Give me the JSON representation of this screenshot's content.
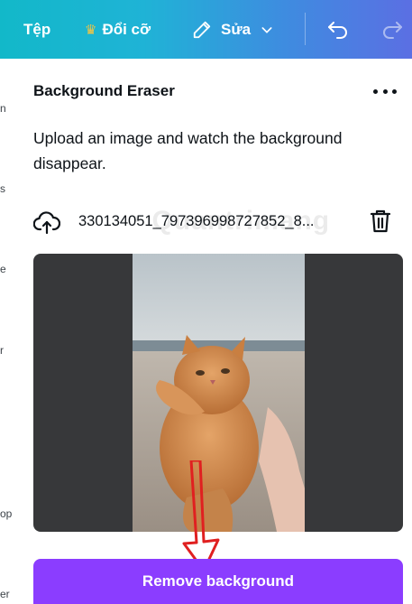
{
  "toolbar": {
    "file_label": "Tệp",
    "resize_label": "Đổi cỡ",
    "edit_label": "Sửa"
  },
  "left_panel_fragments": [
    "n",
    "s",
    "e",
    "r",
    "op",
    "er"
  ],
  "panel": {
    "title": "Background Eraser",
    "description": "Upload an image and watch the background disappear.",
    "file_name": "330134051_797396998727852_8..."
  },
  "actions": {
    "remove_background_label": "Remove background"
  },
  "colors": {
    "toolbar_gradient_start": "#12b8c9",
    "toolbar_gradient_end": "#5b6fe3",
    "accent_purple": "#8b3dff",
    "preview_bg": "#37383a",
    "annotation_red": "#e02020"
  },
  "icons": [
    "crown-icon",
    "pencil-icon",
    "chevron-down-icon",
    "undo-icon",
    "redo-icon",
    "more-icon",
    "upload-cloud-icon",
    "trash-icon",
    "arrow-annotation"
  ]
}
